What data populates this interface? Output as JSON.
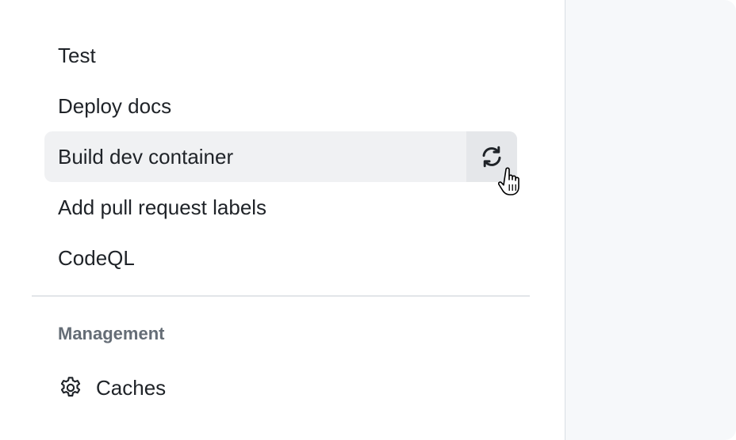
{
  "sidebar": {
    "workflows": [
      {
        "label": "Test"
      },
      {
        "label": "Deploy docs"
      },
      {
        "label": "Build dev container",
        "active": true
      },
      {
        "label": "Add pull request labels"
      },
      {
        "label": "CodeQL"
      }
    ],
    "management": {
      "heading": "Management",
      "items": [
        {
          "label": "Caches",
          "icon": "gear-icon"
        }
      ]
    },
    "rerun_icon": "sync-icon"
  },
  "colors": {
    "text": "#1f2328",
    "muted": "#656d76",
    "active_bg": "#f0f1f3",
    "button_bg": "#e5e7ea",
    "pane_bg": "#f6f8fa"
  }
}
